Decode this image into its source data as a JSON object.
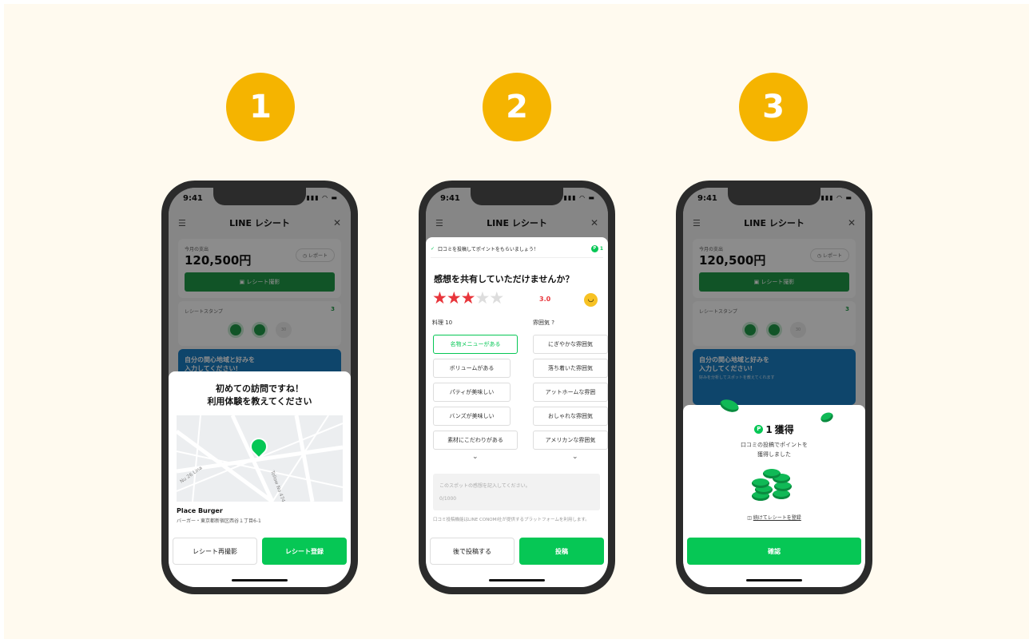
{
  "steps": [
    "1",
    "2",
    "3"
  ],
  "status": {
    "time": "9:41",
    "signal": "▮▮▮ ◠ ▬"
  },
  "header": {
    "menu_icon": "☰",
    "title": "LINE レシート",
    "close_icon": "✕"
  },
  "home": {
    "spend_label": "今月の支出",
    "spend_amount": "120,500円",
    "report_button": "◷ レポート",
    "scan_button": "▣ レシート撮影",
    "stamp_label": "レシートスタンプ",
    "stamp_count": "3",
    "stamp_off_label": "30",
    "banner_line1": "自分の関心地域と好みを",
    "banner_line2": "入力してください!",
    "banner_sub": "好みを分析してスポットを教えてくれます"
  },
  "screen1": {
    "title_line1": "初めての訪問ですね！",
    "title_line2": "利用体験を教えてください",
    "map_labels": [
      "Nu 26 Lina",
      "Tollow No 4744 Ln"
    ],
    "place_name": "Place Burger",
    "place_address": "バーガー・東京都新宿区西谷１丁目6-1",
    "retake_button": "レシート再撮影",
    "register_button": "レシート登録"
  },
  "screen2": {
    "banner_text": "口コミを投稿してポイントをもらいましょう！",
    "banner_points": "1",
    "question": "感想を共有していただけませんか？",
    "rating": 3,
    "rating_text": "3.0",
    "col1_label": "料理 10",
    "col2_label": "雰囲気 ?",
    "col1_chips": [
      "名物メニューがある",
      "ボリュームがある",
      "パティが美味しい",
      "バンズが美味しい",
      "素材にこだわりがある"
    ],
    "col2_chips": [
      "にぎやかな雰囲気",
      "落ち着いた雰囲気",
      "アットホームな雰囲",
      "おしゃれな雰囲気",
      "アメリカンな雰囲気"
    ],
    "textarea_placeholder": "このスポットの感想を記入してください。",
    "char_count": "0/1000",
    "notice": "口コミ投稿機能はLINE CONOMI社が提供するプラットフォームを利用します。",
    "later_button": "後で投稿する",
    "post_button": "投稿"
  },
  "screen3": {
    "earned_points": "1",
    "earned_label": "獲得",
    "message_line1": "口コミの投稿でポイントを",
    "message_line2": "獲得しました",
    "continue_link": "続けてレシートを登録",
    "confirm_button": "確認"
  },
  "colors": {
    "step": "#f5b400",
    "line_green": "#06c755",
    "star": "#e8353b",
    "banner": "#1b7fc4"
  }
}
